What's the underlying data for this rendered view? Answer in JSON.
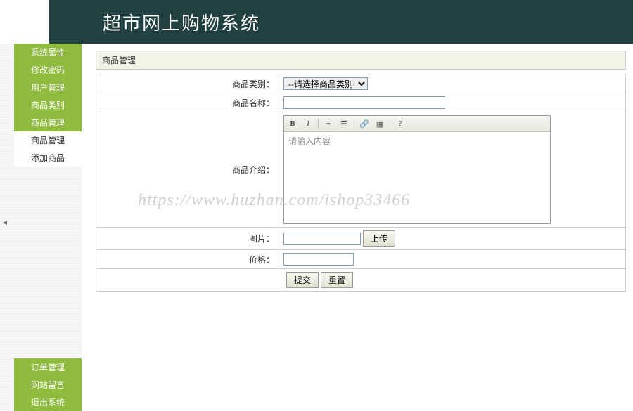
{
  "header": {
    "title": "超市网上购物系统"
  },
  "sidebar": {
    "top": [
      {
        "label": "系统属性",
        "active": false,
        "name": "sidebar-item-system-props"
      },
      {
        "label": "修改密码",
        "active": false,
        "name": "sidebar-item-change-password"
      },
      {
        "label": "用户管理",
        "active": false,
        "name": "sidebar-item-user-mgmt"
      },
      {
        "label": "商品类别",
        "active": false,
        "name": "sidebar-item-product-category"
      },
      {
        "label": "商品管理",
        "active": false,
        "name": "sidebar-item-product-mgmt-header"
      },
      {
        "label": "商品管理",
        "active": true,
        "name": "sidebar-item-product-mgmt"
      },
      {
        "label": "添加商品",
        "active": true,
        "name": "sidebar-item-add-product"
      }
    ],
    "bottom": [
      {
        "label": "订单管理",
        "name": "sidebar-item-order-mgmt"
      },
      {
        "label": "网站留言",
        "name": "sidebar-item-site-messages"
      },
      {
        "label": "退出系统",
        "name": "sidebar-item-logout"
      }
    ]
  },
  "panel": {
    "title": "商品管理"
  },
  "form": {
    "category_label": "商品类别：",
    "category_placeholder": "--请选择商品类别--",
    "name_label": "商品名称：",
    "desc_label": "商品介绍：",
    "editor_placeholder": "请输入内容",
    "image_label": "图片：",
    "upload_btn": "上传",
    "price_label": "价格：",
    "submit_btn": "提交",
    "reset_btn": "重置"
  },
  "watermark": "https://www.huzhan.com/ishop33466"
}
